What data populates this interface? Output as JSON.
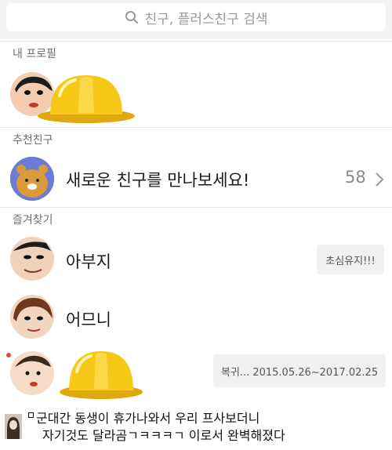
{
  "search": {
    "placeholder": "친구, 플러스친구 검색"
  },
  "sections": {
    "my_profile": "내 프로필",
    "recommended": "추천친구",
    "favorites": "즐겨찾기"
  },
  "recommend_row": {
    "label": "새로운 친구를 만나보세요!",
    "count": "58"
  },
  "favorites": [
    {
      "name": "아부지",
      "status": "초심유지!!!"
    },
    {
      "name": "어므니",
      "status": ""
    },
    {
      "name": "",
      "status": "복귀... 2015.05.26~2017.02.25"
    }
  ],
  "caption": {
    "line1": "군대간 동생이 휴가나와서 우리 프사보더니",
    "line2": "자기것도 달라곰ㄱㅋㅋㅋㄱ 이로서 완벽해졌다"
  },
  "colors": {
    "hat": "#f6c919",
    "hat_shadow": "#e0a80f",
    "badge_dot": "#e24b3b",
    "ryan": "#d99a3a"
  }
}
